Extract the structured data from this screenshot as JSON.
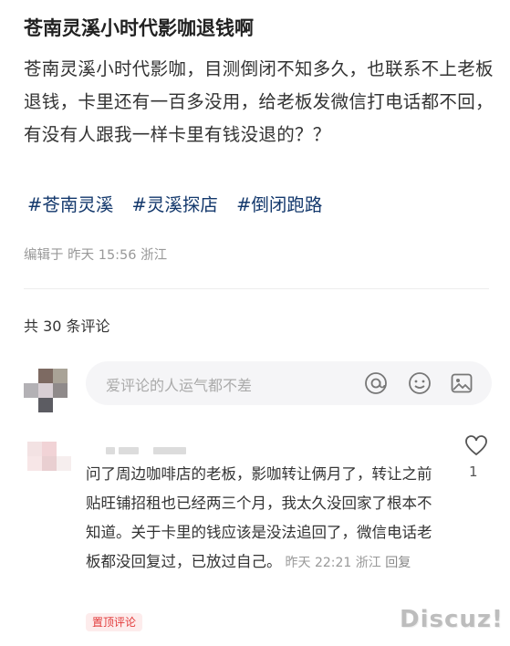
{
  "post": {
    "title": "苍南灵溪小时代影咖退钱啊",
    "body": "苍南灵溪小时代影咖，目测倒闭不知多久，也联系不上老板退钱，卡里还有一百多没用，给老板发微信打电话都不回，有没有人跟我一样卡里有钱没退的？？",
    "tags": [
      "#苍南灵溪",
      "#灵溪探店",
      "#倒闭跑路"
    ],
    "meta": "编辑于  昨天 15:56 浙江"
  },
  "comments_header": {
    "count_label": "共 30 条评论"
  },
  "comment_input": {
    "placeholder": "爱评论的人运气都不差",
    "icons": [
      "at-icon",
      "emoji-icon",
      "image-icon"
    ]
  },
  "comments": [
    {
      "text": "问了周边咖啡店的老板，影咖转让俩月了，转让之前贴旺铺招租也已经两三个月，我太久没回家了根本不知道。关于卡里的钱应该是没法追回了，微信电话老板都没回复过，已放过自己。",
      "time": "昨天 22:21 浙江",
      "reply_label": "回复",
      "likes": "1",
      "badge": "置顶评论"
    }
  ],
  "watermark": "Discuz!",
  "colors": {
    "tag": "#13386c",
    "badge_text": "#e23a3a",
    "badge_bg": "#fdecec"
  }
}
